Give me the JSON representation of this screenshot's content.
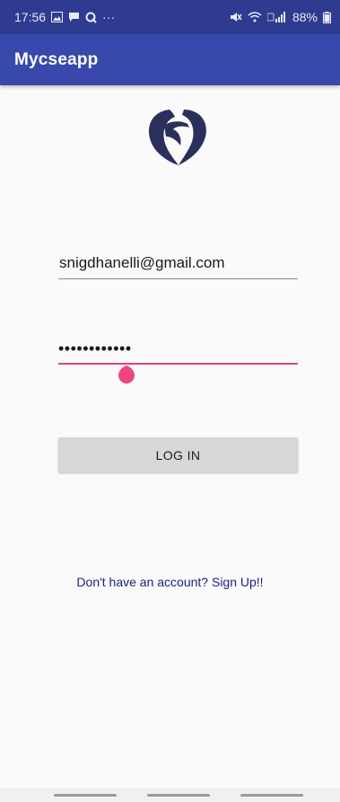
{
  "status_bar": {
    "time": "17:56",
    "battery": "88%",
    "left_icons": [
      "image-icon",
      "chat-icon",
      "q-icon",
      "more-icon"
    ],
    "right_icons": [
      "mute-icon",
      "wifi-icon",
      "signal-icon",
      "battery-icon"
    ],
    "more": "···"
  },
  "app_bar": {
    "title": "Mycseapp"
  },
  "form": {
    "email_value": "snigdhanelli@gmail.com",
    "password_value": "••••••••••••",
    "login_label": "LOG IN",
    "signup_text": "Don't have an account? Sign Up!!"
  },
  "colors": {
    "primary": "#3949ab",
    "primary_dark": "#2f3b91",
    "accent": "#e0457b",
    "link": "#1a237e",
    "logo": "#2b2f5c"
  }
}
